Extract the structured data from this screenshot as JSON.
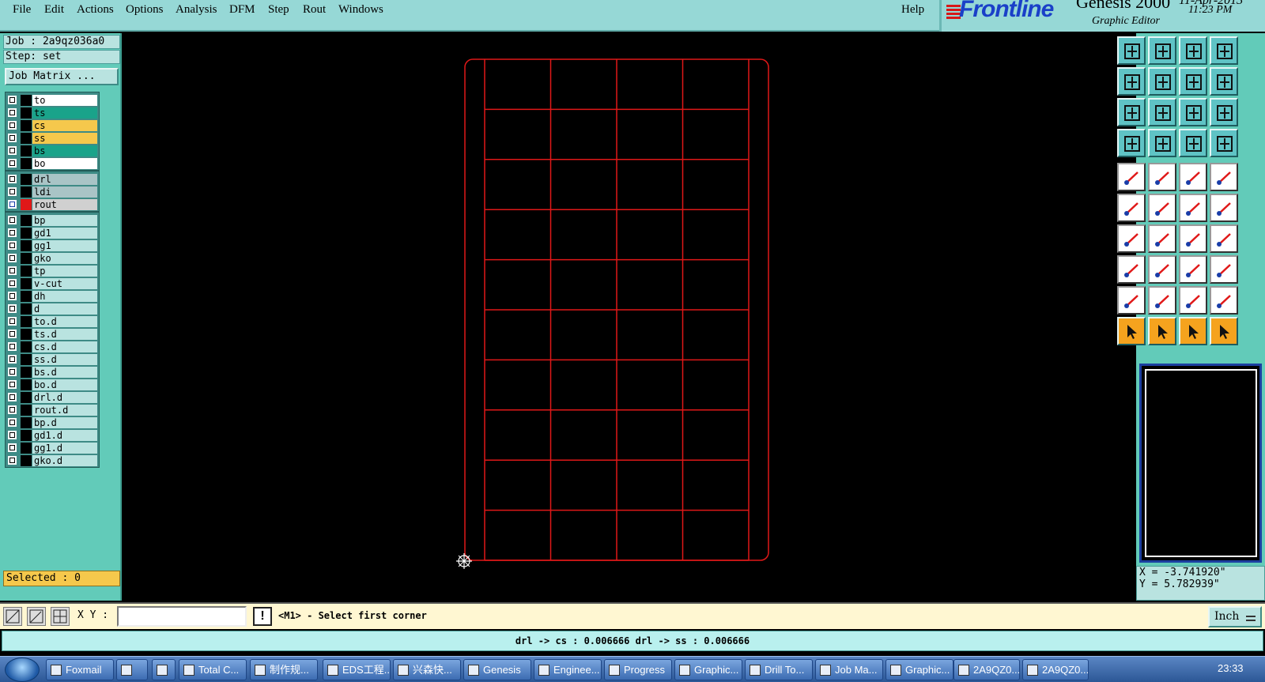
{
  "menu": {
    "items": [
      "File",
      "Edit",
      "Actions",
      "Options",
      "Analysis",
      "DFM",
      "Step",
      "Rout",
      "Windows"
    ],
    "help": "Help"
  },
  "logo": {
    "brand": "Frontline",
    "product": "Genesis 2000",
    "subtitle": "Graphic Editor",
    "date": "11-Apr-2013",
    "time": "11:23 PM"
  },
  "job": {
    "job_label": "Job : 2a9qz036a0",
    "step_label": "Step: set",
    "matrix_button": "Job Matrix ..."
  },
  "layers": {
    "group1": [
      {
        "name": "to",
        "bg": "#ffffff"
      },
      {
        "name": "ts",
        "bg": "#1aa38a"
      },
      {
        "name": "cs",
        "bg": "#f5c84c"
      },
      {
        "name": "ss",
        "bg": "#f5c84c"
      },
      {
        "name": "bs",
        "bg": "#1aa38a"
      },
      {
        "name": "bo",
        "bg": "#ffffff"
      }
    ],
    "group2": [
      {
        "name": "drl",
        "bg": "#a9c4c6"
      },
      {
        "name": "ldi",
        "bg": "#a9c4c6"
      },
      {
        "name": "rout",
        "bg": "#d0d0d0",
        "active": true
      }
    ],
    "group3": [
      {
        "name": "bp"
      },
      {
        "name": "gd1"
      },
      {
        "name": "gg1"
      },
      {
        "name": "gko"
      },
      {
        "name": "tp"
      },
      {
        "name": "v-cut"
      },
      {
        "name": "dh"
      },
      {
        "name": "d"
      },
      {
        "name": "to.d"
      },
      {
        "name": "ts.d"
      },
      {
        "name": "cs.d"
      },
      {
        "name": "ss.d"
      },
      {
        "name": "bs.d"
      },
      {
        "name": "bo.d"
      },
      {
        "name": "drl.d"
      },
      {
        "name": "rout.d"
      },
      {
        "name": "bp.d"
      },
      {
        "name": "gd1.d"
      },
      {
        "name": "gg1.d"
      },
      {
        "name": "gko.d"
      }
    ],
    "default_bg": "#b9e3e0"
  },
  "selected": "Selected : 0",
  "coords": {
    "x": "X = -3.741920\"",
    "y": "Y = 5.782939\""
  },
  "command": {
    "xy_label": "X Y :",
    "xy_value": "",
    "alert": "!",
    "prompt": "<M1> - Select first corner",
    "units": "Inch"
  },
  "status": "drl -> cs : 0.006666   drl -> ss : 0.006666",
  "taskbar": {
    "items": [
      "Foxmail",
      "",
      "",
      "Total C...",
      "制作规...",
      "EDS工程...",
      "兴森快...",
      "Genesis",
      "Enginee...",
      "Progress",
      "Graphic...",
      "Drill To...",
      "Job Ma...",
      "Graphic...",
      "2A9QZ0...",
      "2A9QZ0..."
    ],
    "clock": "23:33"
  },
  "colors": {
    "rout_lines": "#e01818",
    "panel": "#62cbb9",
    "menubar": "#96d8d6",
    "highlight_layer": "#f5c84c"
  },
  "panel": {
    "columns": 4,
    "rows": 10
  }
}
